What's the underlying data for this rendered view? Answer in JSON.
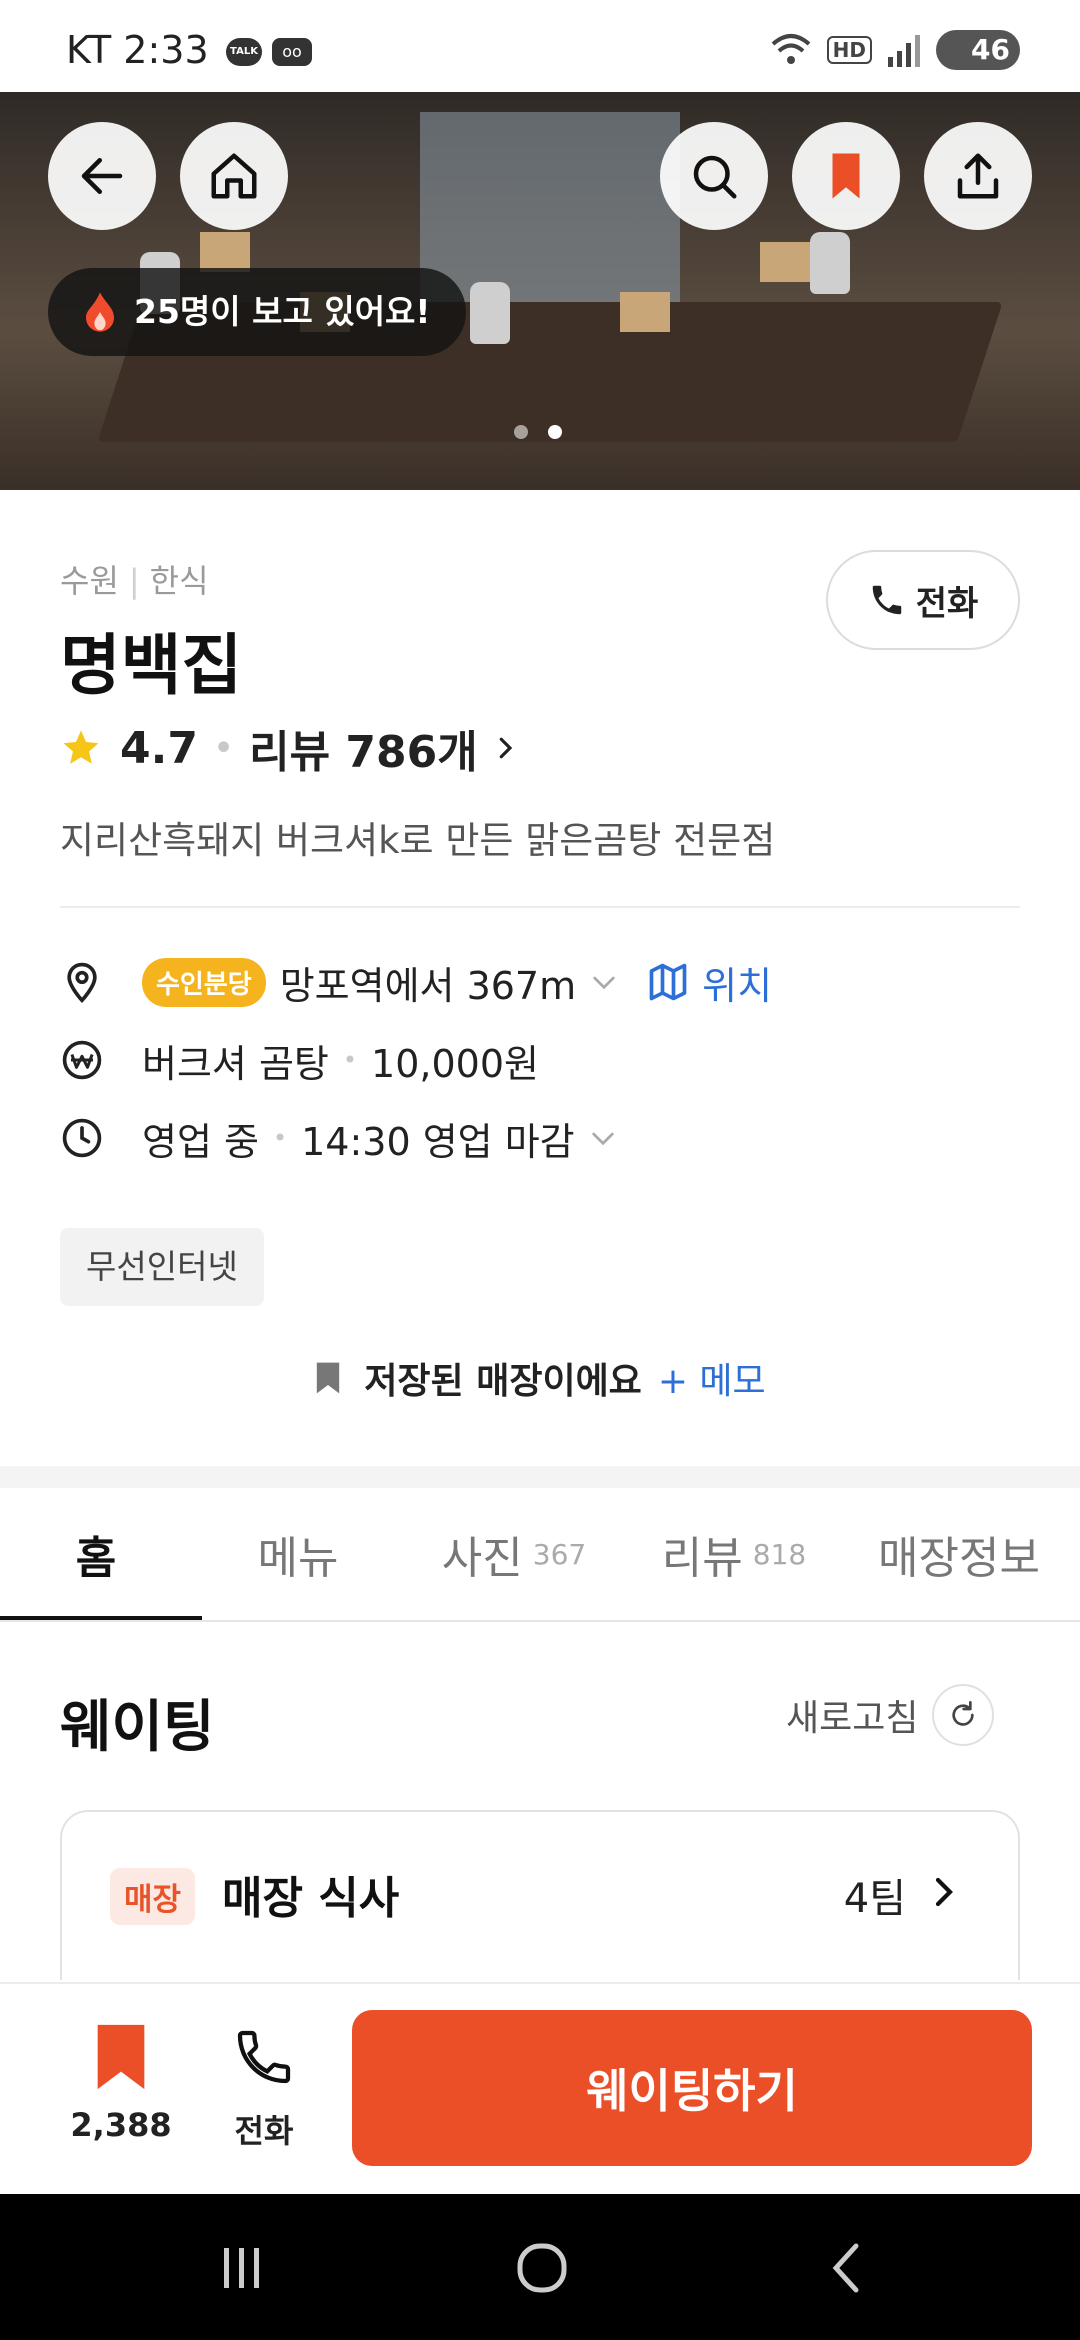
{
  "status_bar": {
    "carrier": "KT",
    "time": "2:33",
    "talk_icon_label": "TALK",
    "battery": "46"
  },
  "hero": {
    "viewers_badge": "25명이 보고 있어요!",
    "dots": 2,
    "active_dot": 1
  },
  "store": {
    "region": "수원",
    "category": "한식",
    "name": "명백집",
    "call_label": "전화",
    "rating": "4.7",
    "review_link": "리뷰 786개",
    "description": "지리산흑돼지 버크셔k로 만든 맑은곰탕 전문점",
    "branch_tag": "수인분당",
    "distance_text": "망포역에서 367m",
    "map_link": "위치",
    "menu_name": "버크셔 곰탕",
    "menu_price": "10,000원",
    "status": "영업 중",
    "close_time": "14:30 영업 마감",
    "facility": "무선인터넷",
    "saved_text": "저장된 매장이에요",
    "memo_link": "+ 메모"
  },
  "tabs": [
    {
      "label": "홈",
      "count": ""
    },
    {
      "label": "메뉴",
      "count": ""
    },
    {
      "label": "사진",
      "count": "367"
    },
    {
      "label": "리뷰",
      "count": "818"
    },
    {
      "label": "매장정보",
      "count": ""
    }
  ],
  "waiting": {
    "title": "웨이팅",
    "refresh_label": "새로고침",
    "card_tag": "매장",
    "card_name": "매장 식사",
    "card_teams": "4팀"
  },
  "bottom": {
    "bookmark_count": "2,388",
    "call_label": "전화",
    "cta_label": "웨이팅하기"
  },
  "colors": {
    "accent": "#ea4f28",
    "link": "#2c6fd6",
    "tag_yellow": "#f5b41e"
  }
}
